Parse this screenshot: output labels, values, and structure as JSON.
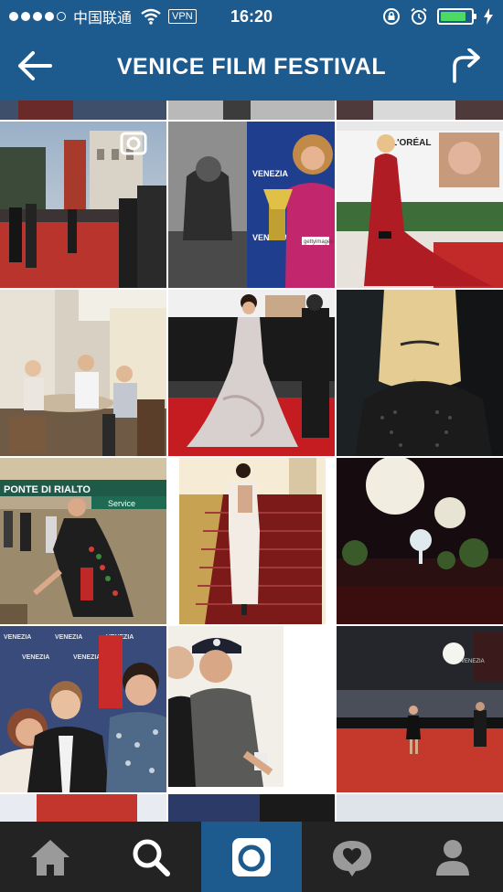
{
  "status_bar": {
    "carrier": "中国联通",
    "vpn": "VPN",
    "time": "16:20",
    "battery_level": 0.85
  },
  "header": {
    "title": "VENICE FILM FESTIVAL",
    "back_icon": "back-arrow-icon",
    "share_icon": "share-arrow-icon"
  },
  "grid": {
    "tiles": [
      {
        "name": "photo-street-crowd-red-carpet"
      },
      {
        "name": "photo-actress-award-trophy"
      },
      {
        "name": "photo-red-gown-loreal"
      },
      {
        "name": "photo-cafe-table-friends"
      },
      {
        "name": "photo-silver-gown-red-carpet"
      },
      {
        "name": "photo-braided-hair-back"
      },
      {
        "name": "photo-ponte-di-rialto"
      },
      {
        "name": "photo-staircase-red-carpet"
      },
      {
        "name": "photo-night-lanterns"
      },
      {
        "name": "photo-group-selfie-backdrop"
      },
      {
        "name": "photo-selfie-cap"
      },
      {
        "name": "photo-night-red-carpet"
      }
    ],
    "posterized_text": {
      "gettyimages": "gettyimages",
      "loreal": "L'ORÉAL",
      "ponte": "PONTE DI RIALTO",
      "service": "Service",
      "venice": "VENEZIA"
    }
  },
  "tab_bar": {
    "tabs": [
      {
        "icon": "home-icon",
        "active": false
      },
      {
        "icon": "search-icon",
        "active": false
      },
      {
        "icon": "camera-icon",
        "active": true
      },
      {
        "icon": "activity-heart-icon",
        "active": false
      },
      {
        "icon": "profile-icon",
        "active": false
      }
    ]
  },
  "colors": {
    "brand_blue": "#1d5a8e",
    "tab_bar": "#232323",
    "battery_green": "#4cd964"
  }
}
